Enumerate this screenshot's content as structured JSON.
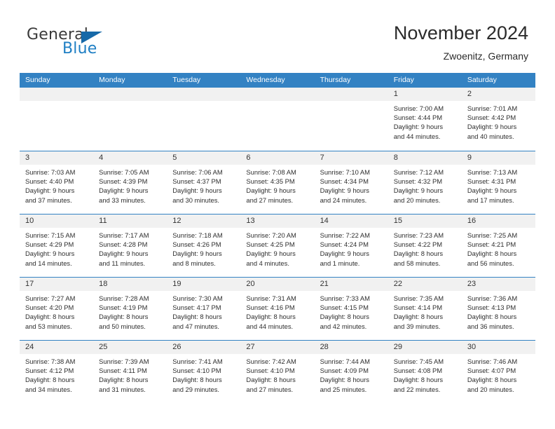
{
  "brand": {
    "name_part1": "General",
    "name_part2": "Blue",
    "flag_icon": "triangle-flag-icon",
    "accent_color": "#1769a8",
    "blue_text_color": "#1f7fc4"
  },
  "header": {
    "month_title": "November 2024",
    "location": "Zwoenitz, Germany"
  },
  "theme": {
    "header_row_bg": "#3382c3",
    "day_strip_bg": "#f1f1f1",
    "cell_bg": "#ffffff",
    "row_border": "#3382c3"
  },
  "weekdays": [
    {
      "label": "Sunday"
    },
    {
      "label": "Monday"
    },
    {
      "label": "Tuesday"
    },
    {
      "label": "Wednesday"
    },
    {
      "label": "Thursday"
    },
    {
      "label": "Friday"
    },
    {
      "label": "Saturday"
    }
  ],
  "weeks": [
    {
      "days": [
        {
          "num": "",
          "lines": [
            "",
            "",
            "",
            ""
          ],
          "empty": true
        },
        {
          "num": "",
          "lines": [
            "",
            "",
            "",
            ""
          ],
          "empty": true
        },
        {
          "num": "",
          "lines": [
            "",
            "",
            "",
            ""
          ],
          "empty": true
        },
        {
          "num": "",
          "lines": [
            "",
            "",
            "",
            ""
          ],
          "empty": true
        },
        {
          "num": "",
          "lines": [
            "",
            "",
            "",
            ""
          ],
          "empty": true
        },
        {
          "num": "1",
          "lines": [
            "Sunrise: 7:00 AM",
            "Sunset: 4:44 PM",
            "Daylight: 9 hours",
            "and 44 minutes."
          ],
          "empty": false
        },
        {
          "num": "2",
          "lines": [
            "Sunrise: 7:01 AM",
            "Sunset: 4:42 PM",
            "Daylight: 9 hours",
            "and 40 minutes."
          ],
          "empty": false
        }
      ]
    },
    {
      "days": [
        {
          "num": "3",
          "lines": [
            "Sunrise: 7:03 AM",
            "Sunset: 4:40 PM",
            "Daylight: 9 hours",
            "and 37 minutes."
          ],
          "empty": false
        },
        {
          "num": "4",
          "lines": [
            "Sunrise: 7:05 AM",
            "Sunset: 4:39 PM",
            "Daylight: 9 hours",
            "and 33 minutes."
          ],
          "empty": false
        },
        {
          "num": "5",
          "lines": [
            "Sunrise: 7:06 AM",
            "Sunset: 4:37 PM",
            "Daylight: 9 hours",
            "and 30 minutes."
          ],
          "empty": false
        },
        {
          "num": "6",
          "lines": [
            "Sunrise: 7:08 AM",
            "Sunset: 4:35 PM",
            "Daylight: 9 hours",
            "and 27 minutes."
          ],
          "empty": false
        },
        {
          "num": "7",
          "lines": [
            "Sunrise: 7:10 AM",
            "Sunset: 4:34 PM",
            "Daylight: 9 hours",
            "and 24 minutes."
          ],
          "empty": false
        },
        {
          "num": "8",
          "lines": [
            "Sunrise: 7:12 AM",
            "Sunset: 4:32 PM",
            "Daylight: 9 hours",
            "and 20 minutes."
          ],
          "empty": false
        },
        {
          "num": "9",
          "lines": [
            "Sunrise: 7:13 AM",
            "Sunset: 4:31 PM",
            "Daylight: 9 hours",
            "and 17 minutes."
          ],
          "empty": false
        }
      ]
    },
    {
      "days": [
        {
          "num": "10",
          "lines": [
            "Sunrise: 7:15 AM",
            "Sunset: 4:29 PM",
            "Daylight: 9 hours",
            "and 14 minutes."
          ],
          "empty": false
        },
        {
          "num": "11",
          "lines": [
            "Sunrise: 7:17 AM",
            "Sunset: 4:28 PM",
            "Daylight: 9 hours",
            "and 11 minutes."
          ],
          "empty": false
        },
        {
          "num": "12",
          "lines": [
            "Sunrise: 7:18 AM",
            "Sunset: 4:26 PM",
            "Daylight: 9 hours",
            "and 8 minutes."
          ],
          "empty": false
        },
        {
          "num": "13",
          "lines": [
            "Sunrise: 7:20 AM",
            "Sunset: 4:25 PM",
            "Daylight: 9 hours",
            "and 4 minutes."
          ],
          "empty": false
        },
        {
          "num": "14",
          "lines": [
            "Sunrise: 7:22 AM",
            "Sunset: 4:24 PM",
            "Daylight: 9 hours",
            "and 1 minute."
          ],
          "empty": false
        },
        {
          "num": "15",
          "lines": [
            "Sunrise: 7:23 AM",
            "Sunset: 4:22 PM",
            "Daylight: 8 hours",
            "and 58 minutes."
          ],
          "empty": false
        },
        {
          "num": "16",
          "lines": [
            "Sunrise: 7:25 AM",
            "Sunset: 4:21 PM",
            "Daylight: 8 hours",
            "and 56 minutes."
          ],
          "empty": false
        }
      ]
    },
    {
      "days": [
        {
          "num": "17",
          "lines": [
            "Sunrise: 7:27 AM",
            "Sunset: 4:20 PM",
            "Daylight: 8 hours",
            "and 53 minutes."
          ],
          "empty": false
        },
        {
          "num": "18",
          "lines": [
            "Sunrise: 7:28 AM",
            "Sunset: 4:19 PM",
            "Daylight: 8 hours",
            "and 50 minutes."
          ],
          "empty": false
        },
        {
          "num": "19",
          "lines": [
            "Sunrise: 7:30 AM",
            "Sunset: 4:17 PM",
            "Daylight: 8 hours",
            "and 47 minutes."
          ],
          "empty": false
        },
        {
          "num": "20",
          "lines": [
            "Sunrise: 7:31 AM",
            "Sunset: 4:16 PM",
            "Daylight: 8 hours",
            "and 44 minutes."
          ],
          "empty": false
        },
        {
          "num": "21",
          "lines": [
            "Sunrise: 7:33 AM",
            "Sunset: 4:15 PM",
            "Daylight: 8 hours",
            "and 42 minutes."
          ],
          "empty": false
        },
        {
          "num": "22",
          "lines": [
            "Sunrise: 7:35 AM",
            "Sunset: 4:14 PM",
            "Daylight: 8 hours",
            "and 39 minutes."
          ],
          "empty": false
        },
        {
          "num": "23",
          "lines": [
            "Sunrise: 7:36 AM",
            "Sunset: 4:13 PM",
            "Daylight: 8 hours",
            "and 36 minutes."
          ],
          "empty": false
        }
      ]
    },
    {
      "days": [
        {
          "num": "24",
          "lines": [
            "Sunrise: 7:38 AM",
            "Sunset: 4:12 PM",
            "Daylight: 8 hours",
            "and 34 minutes."
          ],
          "empty": false
        },
        {
          "num": "25",
          "lines": [
            "Sunrise: 7:39 AM",
            "Sunset: 4:11 PM",
            "Daylight: 8 hours",
            "and 31 minutes."
          ],
          "empty": false
        },
        {
          "num": "26",
          "lines": [
            "Sunrise: 7:41 AM",
            "Sunset: 4:10 PM",
            "Daylight: 8 hours",
            "and 29 minutes."
          ],
          "empty": false
        },
        {
          "num": "27",
          "lines": [
            "Sunrise: 7:42 AM",
            "Sunset: 4:10 PM",
            "Daylight: 8 hours",
            "and 27 minutes."
          ],
          "empty": false
        },
        {
          "num": "28",
          "lines": [
            "Sunrise: 7:44 AM",
            "Sunset: 4:09 PM",
            "Daylight: 8 hours",
            "and 25 minutes."
          ],
          "empty": false
        },
        {
          "num": "29",
          "lines": [
            "Sunrise: 7:45 AM",
            "Sunset: 4:08 PM",
            "Daylight: 8 hours",
            "and 22 minutes."
          ],
          "empty": false
        },
        {
          "num": "30",
          "lines": [
            "Sunrise: 7:46 AM",
            "Sunset: 4:07 PM",
            "Daylight: 8 hours",
            "and 20 minutes."
          ],
          "empty": false
        }
      ]
    }
  ]
}
